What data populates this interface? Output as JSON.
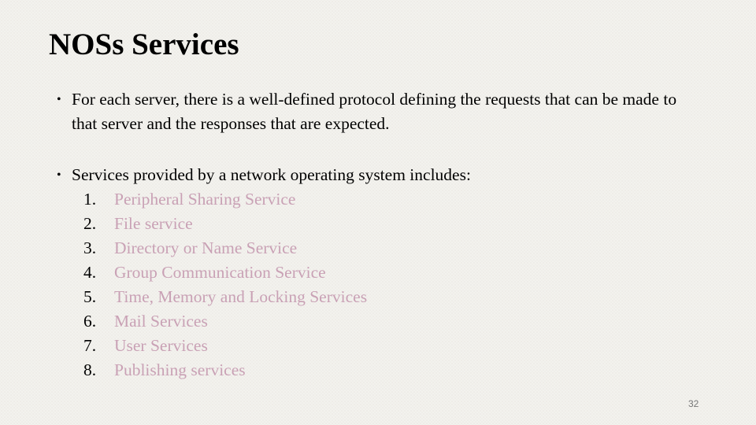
{
  "slide": {
    "title": "NOSs Services",
    "bullets": [
      {
        "marker": "•",
        "text": "For each server, there is a well-defined protocol defining the requests that can be made to that server and the responses that are expected."
      },
      {
        "marker": "•",
        "text": "Services provided by a network operating system includes:"
      }
    ],
    "services": [
      {
        "number": "1.",
        "label": "Peripheral Sharing Service"
      },
      {
        "number": "2.",
        "label": "File service"
      },
      {
        "number": "3.",
        "label": "Directory or Name Service"
      },
      {
        "number": "4.",
        "label": "Group Communication Service"
      },
      {
        "number": "5.",
        "label": "Time, Memory and Locking Services"
      },
      {
        "number": "6.",
        "label": "Mail Services"
      },
      {
        "number": "7.",
        "label": "User Services"
      },
      {
        "number": "8.",
        "label": "Publishing services"
      }
    ],
    "page_number": "32",
    "colors": {
      "title": "#000000",
      "body_text": "#000000",
      "list_item_text": "#c9a1b5",
      "background": "#f3f2ee"
    }
  }
}
